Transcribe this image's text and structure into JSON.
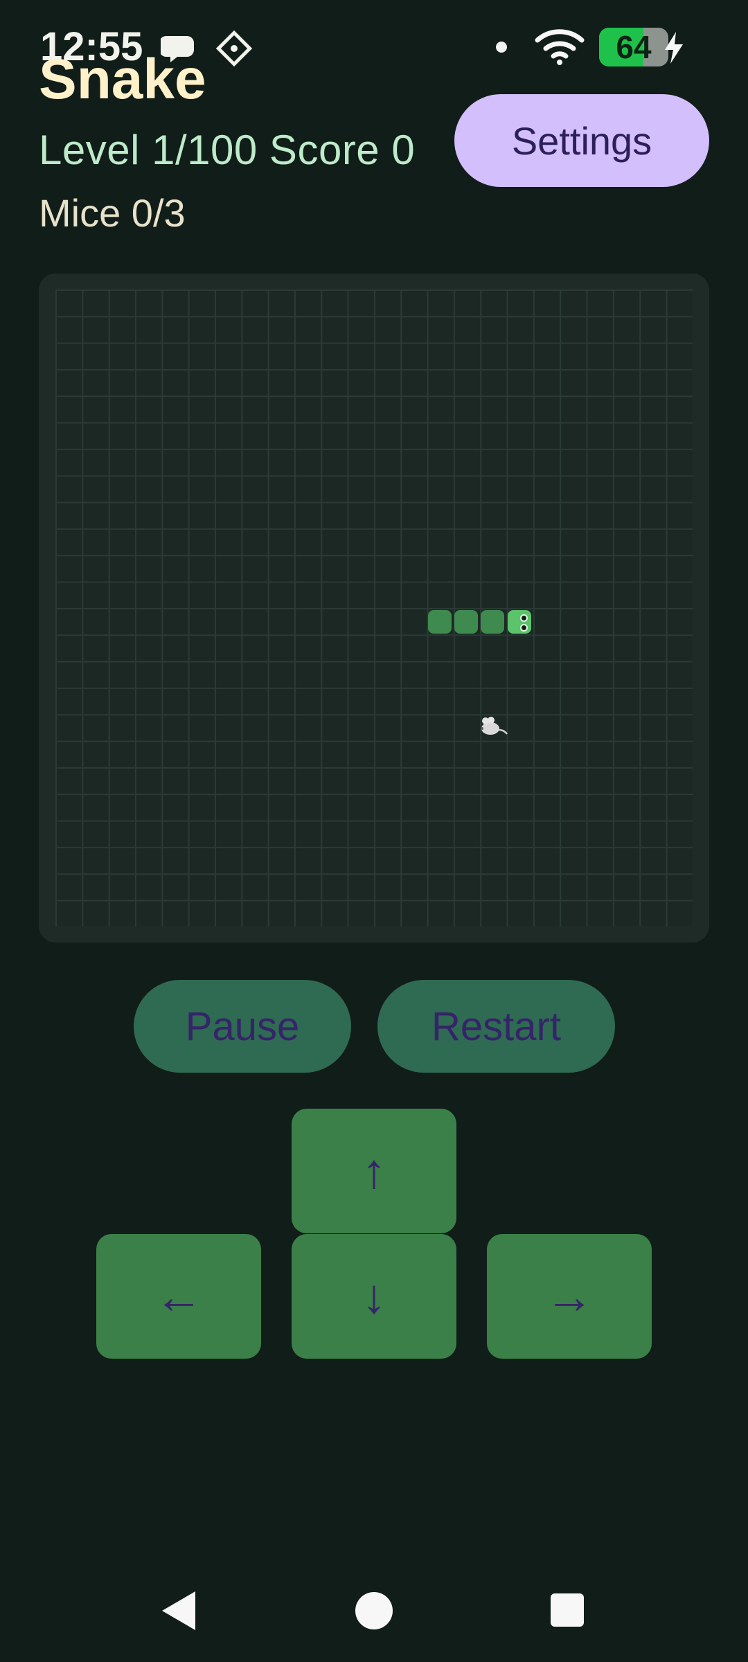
{
  "status_bar": {
    "time": "12:55",
    "battery": "64",
    "icons": [
      "chat-bubble-icon",
      "diamond-network-icon",
      "notification-dot-icon",
      "wifi-icon",
      "battery-icon",
      "charging-bolt-icon"
    ]
  },
  "header": {
    "title": "Snake",
    "level_score": "Level 1/100  Score 0",
    "mice": "Mice 0/3",
    "settings_label": "Settings"
  },
  "board": {
    "grid_size": 24,
    "snake_color": "#3e8a4f",
    "snake_head_color": "#5bc46b",
    "mouse_icon": "mouse-icon"
  },
  "controls": {
    "pause_label": "Pause",
    "restart_label": "Restart",
    "up": "↑",
    "down": "↓",
    "left": "←",
    "right": "→"
  },
  "nav": {
    "icons": [
      "back-icon",
      "home-icon",
      "recents-icon"
    ]
  }
}
